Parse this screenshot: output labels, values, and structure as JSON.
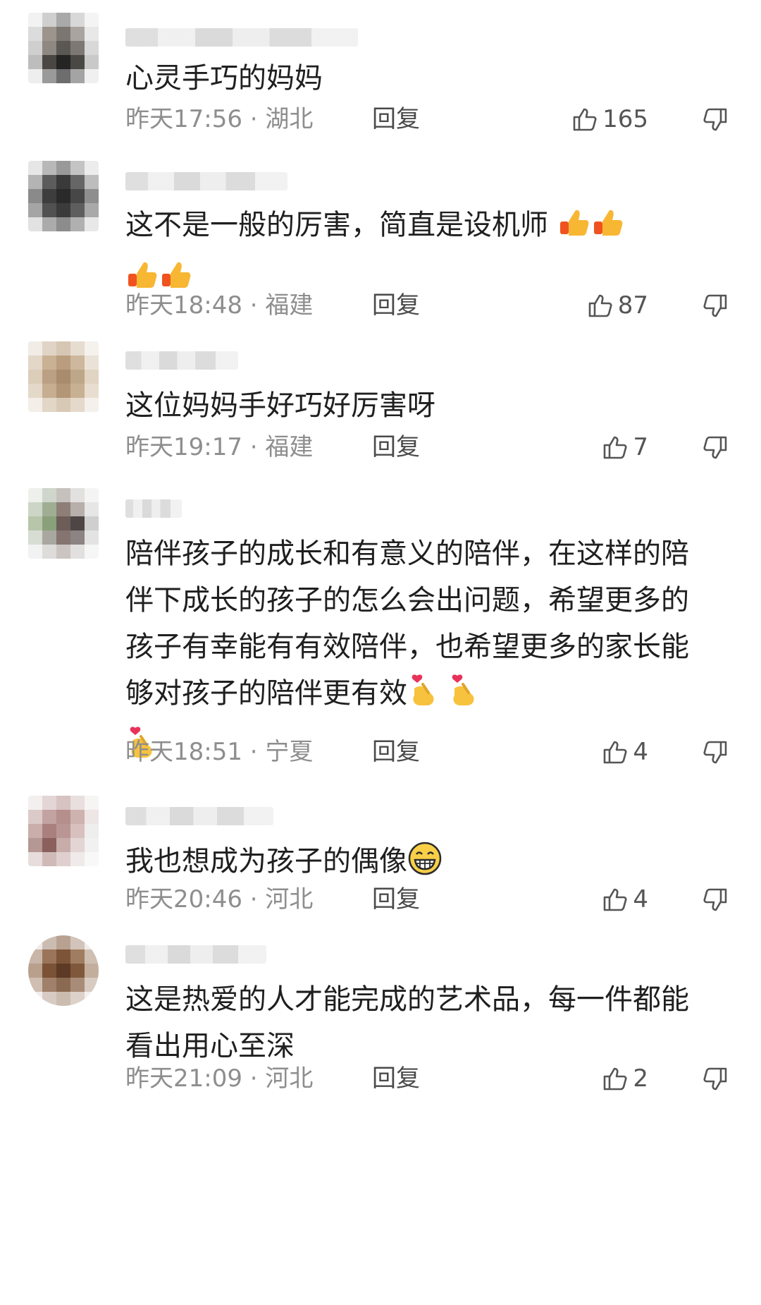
{
  "comments": [
    {
      "text": "心灵手巧的妈妈",
      "time": "昨天17:56",
      "location": "湖北",
      "reply_label": "回复",
      "likes": "165",
      "emoji": []
    },
    {
      "text": "这不是一般的厉害，简直是设机师",
      "time": "昨天18:48",
      "location": "福建",
      "reply_label": "回复",
      "likes": "87",
      "emoji": [
        "thumbs-up-icon",
        "thumbs-up-icon",
        "thumbs-up-icon",
        "thumbs-up-icon"
      ]
    },
    {
      "text": "这位妈妈手好巧好厉害呀",
      "time": "昨天19:17",
      "location": "福建",
      "reply_label": "回复",
      "likes": "7",
      "emoji": []
    },
    {
      "text": "陪伴孩子的成长和有意义的陪伴，在这样的陪伴下成长的孩子的怎么会出问题，希望更多的孩子有幸能有有效陪伴，也希望更多的家长能够对孩子的陪伴更有效",
      "time": "昨天18:51",
      "location": "宁夏",
      "reply_label": "回复",
      "likes": "4",
      "emoji": [
        "finger-heart-icon",
        "finger-heart-icon",
        "finger-heart-icon"
      ]
    },
    {
      "text": "我也想成为孩子的偶像",
      "time": "昨天20:46",
      "location": "河北",
      "reply_label": "回复",
      "likes": "4",
      "emoji": [
        "grinning-face-icon"
      ]
    },
    {
      "text": "这是热爱的人才能完成的艺术品，每一件都能看出用心至深",
      "time": "昨天21:09",
      "location": "河北",
      "reply_label": "回复",
      "likes": "2",
      "emoji": []
    }
  ],
  "separator": " · ",
  "colors": {
    "text": "#1f1f1f",
    "meta": "#8e8e8e",
    "thumb_orange": "#f0531f",
    "thumb_yellow": "#f7b733"
  }
}
